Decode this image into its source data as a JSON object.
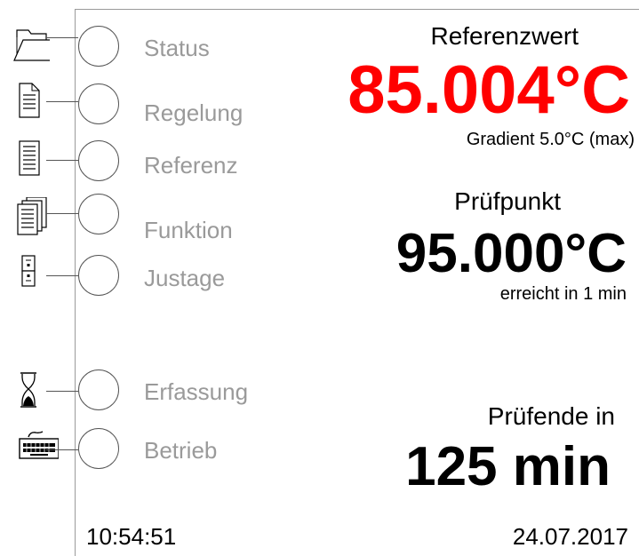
{
  "menu": {
    "items": [
      {
        "label": "Status",
        "icon": "folder-icon"
      },
      {
        "label": "Regelung",
        "icon": "document-icon"
      },
      {
        "label": "Referenz",
        "icon": "list-document-icon"
      },
      {
        "label": "Funktion",
        "icon": "stacked-documents-icon"
      },
      {
        "label": "Justage",
        "icon": "adjustment-icon"
      },
      {
        "label": "Erfassung",
        "icon": "hourglass-icon"
      },
      {
        "label": "Betrieb",
        "icon": "keyboard-icon"
      }
    ]
  },
  "reference": {
    "label": "Referenzwert",
    "value": "85.004°C",
    "gradient": "Gradient 5.0°C (max)",
    "value_color": "#ff0000"
  },
  "testpoint": {
    "label": "Prüfpunkt",
    "value": "95.000°C",
    "reached": "erreicht in 1 min"
  },
  "test_end": {
    "label": "Prüfende in",
    "value": "125 min"
  },
  "footer": {
    "time": "10:54:51",
    "date": "24.07.2017"
  }
}
